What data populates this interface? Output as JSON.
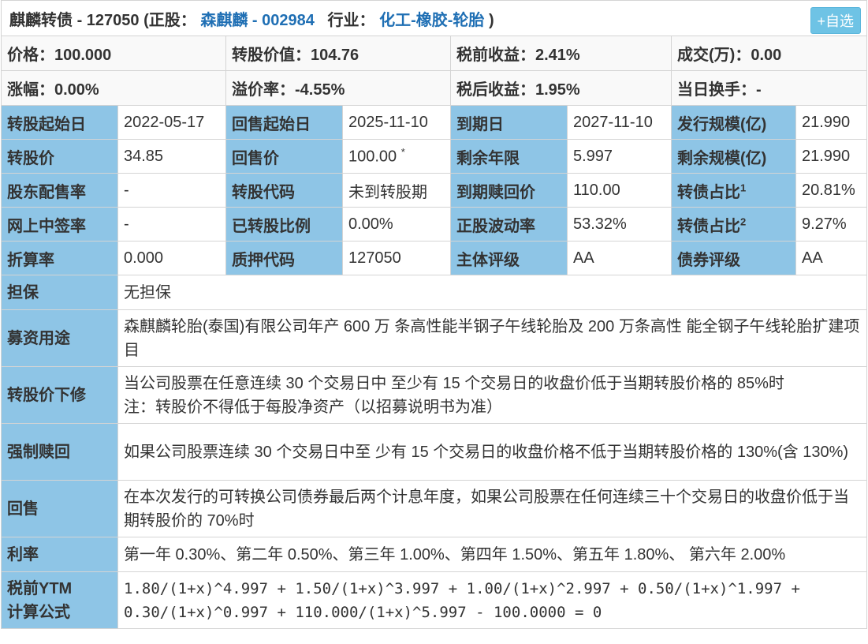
{
  "header": {
    "bond_name": "麒麟转债",
    "bond_code": "127050",
    "stock_prefix": "(正股：",
    "stock_name": "森麒麟",
    "stock_code": "002984",
    "industry_label": "行业：",
    "industry": "化工-橡胶-轮胎",
    "close_paren": ")",
    "add_button": "+自选"
  },
  "summary": {
    "price": "价格：100.000",
    "conv_value": "转股价值：104.76",
    "pre_tax_yield": "税前收益：2.41%",
    "volume": "成交(万)：0.00",
    "change": "涨幅：0.00%",
    "premium": "溢价率：-4.55%",
    "after_tax_yield": "税后收益：1.95%",
    "turnover": "当日换手：-"
  },
  "grid": [
    [
      {
        "l": "转股起始日",
        "v": "2022-05-17"
      },
      {
        "l": "回售起始日",
        "v": "2025-11-10"
      },
      {
        "l": "到期日",
        "v": "2027-11-10"
      },
      {
        "l": "发行规模(亿)",
        "v": "21.990"
      }
    ],
    [
      {
        "l": "转股价",
        "v": "34.85"
      },
      {
        "l": "回售价",
        "v": "100.00",
        "sup": "*"
      },
      {
        "l": "剩余年限",
        "v": "5.997"
      },
      {
        "l": "剩余规模(亿)",
        "v": "21.990"
      }
    ],
    [
      {
        "l": "股东配售率",
        "v": "-"
      },
      {
        "l": "转股代码",
        "v": "未到转股期"
      },
      {
        "l": "到期赎回价",
        "v": "110.00"
      },
      {
        "l": "转债占比",
        "lsup": "1",
        "v": "20.81%"
      }
    ],
    [
      {
        "l": "网上中签率",
        "v": "-"
      },
      {
        "l": "已转股比例",
        "v": "0.00%"
      },
      {
        "l": "正股波动率",
        "v": "53.32%"
      },
      {
        "l": "转债占比",
        "lsup": "2",
        "v": "9.27%"
      }
    ],
    [
      {
        "l": "折算率",
        "v": "0.000"
      },
      {
        "l": "质押代码",
        "v": "127050"
      },
      {
        "l": "主体评级",
        "v": "AA"
      },
      {
        "l": "债券评级",
        "v": "AA"
      }
    ]
  ],
  "details": [
    {
      "l": "担保",
      "v": "无担保"
    },
    {
      "l": "募资用途",
      "v": "森麒麟轮胎(泰国)有限公司年产 600 万 条高性能半钢子午线轮胎及 200 万条高性 能全钢子午线轮胎扩建项目"
    },
    {
      "l": "转股价下修",
      "v": "当公司股票在任意连续 30 个交易日中 至少有 15 个交易日的收盘价低于当期转股价格的 85%时",
      "v2": "注：转股价不得低于每股净资产（以招募说明书为准）"
    },
    {
      "l": "强制赎回",
      "v": "如果公司股票连续 30 个交易日中至 少有 15 个交易日的收盘价格不低于当期转股价格的 130%(含 130%)"
    },
    {
      "l": "回售",
      "v": "在本次发行的可转换公司债券最后两个计息年度，如果公司股票在任何连续三十个交易日的收盘价低于当期转股价的 70%时"
    },
    {
      "l": "利率",
      "v": "第一年 0.30%、第二年 0.50%、第三年 1.00%、第四年 1.50%、第五年 1.80%、 第六年 2.00%"
    },
    {
      "l": "税前YTM",
      "l2": "计算公式",
      "v": "1.80/(1+x)^4.997 + 1.50/(1+x)^3.997 + 1.00/(1+x)^2.997 + 0.50/(1+x)^1.997 + 0.30/(1+x)^0.997 + 110.000/(1+x)^5.997 - 100.0000 = 0"
    }
  ]
}
